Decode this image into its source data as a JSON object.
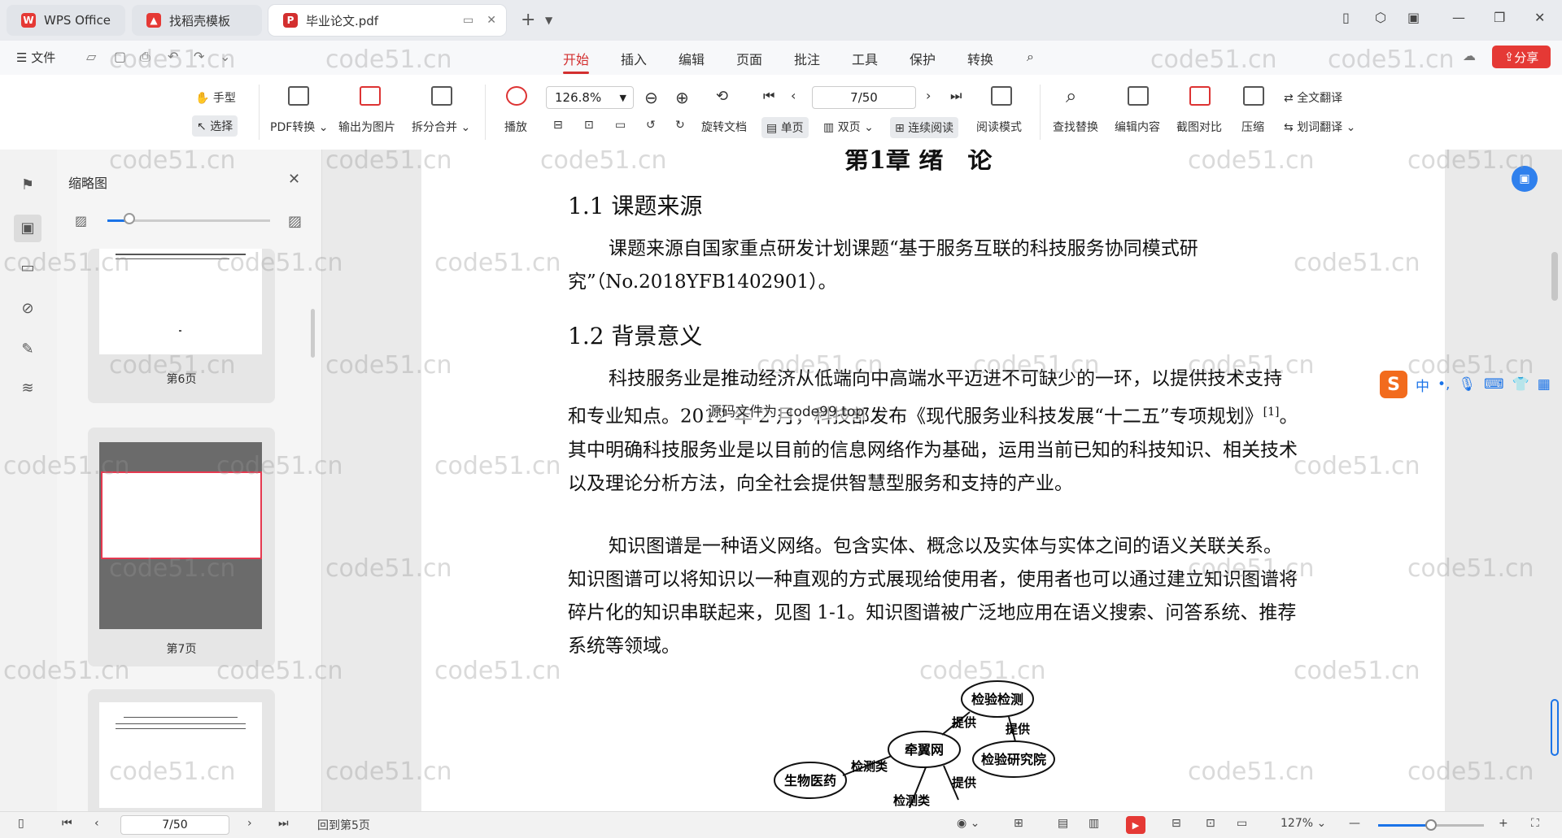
{
  "tabs": [
    {
      "label": "WPS Office",
      "icon": "wps-logo-icon"
    },
    {
      "label": "找稻壳模板",
      "icon": "docer-icon"
    },
    {
      "label": "毕业论文.pdf",
      "icon": "pdf-icon"
    }
  ],
  "menubar": {
    "file_label": "文件",
    "tabs": [
      "开始",
      "插入",
      "编辑",
      "页面",
      "批注",
      "工具",
      "保护",
      "转换"
    ],
    "active_tab": "开始",
    "share_label": "分享"
  },
  "ribbon": {
    "hand": "手型",
    "select": "选择",
    "pdf_convert": "PDF转换",
    "export_image": "输出为图片",
    "split_merge": "拆分合并",
    "play": "播放",
    "zoom_value": "126.8%",
    "rotate_doc": "旋转文档",
    "single_page": "单页",
    "double_page": "双页",
    "continuous_read": "连续阅读",
    "read_mode": "阅读模式",
    "page_value": "7/50",
    "find_replace": "查找替换",
    "edit_content": "编辑内容",
    "screenshot_compare": "截图对比",
    "compress": "压缩",
    "full_translate": "全文翻译",
    "word_translate": "划词翻译"
  },
  "thumbnails": {
    "title": "缩略图",
    "zoom_level": 0.13,
    "pages": [
      {
        "label": "第6页"
      },
      {
        "label": "第7页"
      }
    ]
  },
  "document": {
    "chapter_title": "第1章 绪　论",
    "section1_title": "1.1 课题来源",
    "section1_para": "课题来源自国家重点研发计划课题“基于服务互联的科技服务协同模式研究”（No.2018YFB1402901）。",
    "section2_title": "1.2 背景意义",
    "para2_prefix": "科技服务业是推动经济从低端向中高端水平迈进不可缺少的一环，以提供技术支持和专业知",
    "overlay_text": "源码文件为: code99.top",
    "para2_middle": "点。2012 年 2 月，科技部发布《现代服务业科技发展“十二五”专项规划》",
    "para2_ref": "[1]",
    "para2_suffix": "。其中明确科技服务业是以目前的信息网络作为基础，运用当前已知的科技知识、相关技术以及理论分析方法，向全社会提供智慧型服务和支持的产业。",
    "para3": "知识图谱是一种语义网络。包含实体、概念以及实体与实体之间的语义关联关系。知识图谱可以将知识以一种直观的方式展现给使用者，使用者也可以通过建立知识图谱将碎片化的知识串联起来，见图 1-1。知识图谱被广泛地应用在语义搜索、问答系统、推荐系统等领域。",
    "diagram": {
      "nodes": [
        "检验检测",
        "牵翼网",
        "检验研究院",
        "生物医药"
      ],
      "edges": [
        "提供",
        "提供",
        "检测类",
        "检测类",
        "提供"
      ]
    }
  },
  "ime": {
    "lang": "中",
    "punct": "•,"
  },
  "watermark": "code51.cn",
  "statusbar": {
    "page_value": "7/50",
    "back_label": "回到第5页",
    "zoom_label": "127%"
  }
}
